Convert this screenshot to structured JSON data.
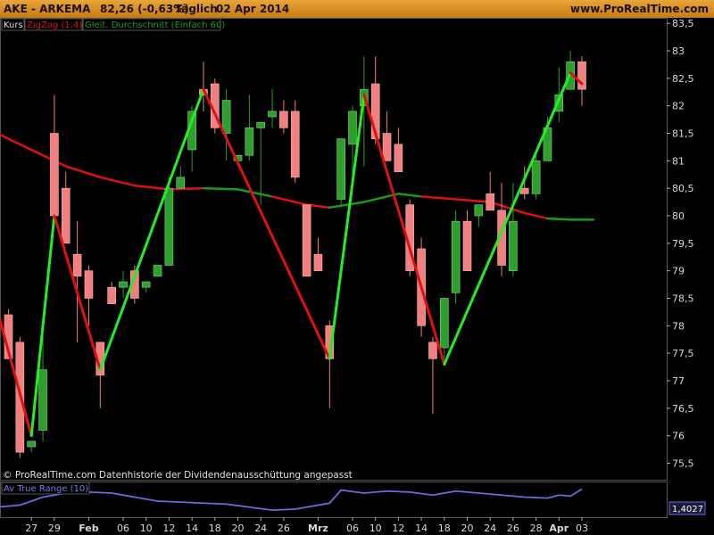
{
  "header": {
    "symbol": "AKE - ARKEMA",
    "price_change": "82,26 (-0,63%)",
    "period": "Täglich",
    "date": "02 Apr 2014",
    "site": "www.ProRealTime.com"
  },
  "legend": {
    "kurs": "Kurs",
    "zigzag": "ZigZag (1,4)",
    "ma": "Gleit. Durchschnitt (Einfach 60)"
  },
  "footer_note": "© ProRealTime.com  Datenhistorie der Dividendenausschüttung angepasst",
  "colors": {
    "up_candle": "#2e9e2e",
    "down_candle": "#f08080",
    "zigzag_up": "#22ee22",
    "zigzag_down": "#dd1111",
    "ma_above": "#dd1111",
    "ma_below": "#1a9a1a",
    "atr_line": "#6b6bdd",
    "title_bar": "#e0962a"
  },
  "chart_data": [
    {
      "type": "candlestick",
      "y_ticks": [
        "75,5",
        "76",
        "76,5",
        "77",
        "77,5",
        "78",
        "78,5",
        "79",
        "79,5",
        "80",
        "80,5",
        "81",
        "81,5",
        "82",
        "82,5",
        "83",
        "83,5"
      ],
      "ylim": [
        75.2,
        83.6
      ],
      "x_ticks": [
        {
          "label": "27",
          "i": 2
        },
        {
          "label": "29",
          "i": 4
        },
        {
          "label": "Feb",
          "i": 7,
          "bold": true
        },
        {
          "label": "06",
          "i": 10
        },
        {
          "label": "10",
          "i": 12
        },
        {
          "label": "12",
          "i": 14
        },
        {
          "label": "14",
          "i": 16
        },
        {
          "label": "18",
          "i": 18
        },
        {
          "label": "20",
          "i": 20
        },
        {
          "label": "24",
          "i": 22
        },
        {
          "label": "26",
          "i": 24
        },
        {
          "label": "Mrz",
          "i": 27,
          "bold": true
        },
        {
          "label": "06",
          "i": 30
        },
        {
          "label": "10",
          "i": 32
        },
        {
          "label": "12",
          "i": 34
        },
        {
          "label": "14",
          "i": 36
        },
        {
          "label": "18",
          "i": 38
        },
        {
          "label": "20",
          "i": 40
        },
        {
          "label": "24",
          "i": 42
        },
        {
          "label": "26",
          "i": 44
        },
        {
          "label": "28",
          "i": 46
        },
        {
          "label": "Apr",
          "i": 48,
          "bold": true
        },
        {
          "label": "03",
          "i": 50
        }
      ],
      "candles": [
        {
          "o": 78.2,
          "h": 78.3,
          "l": 77.4,
          "c": 77.4
        },
        {
          "o": 77.7,
          "h": 77.8,
          "l": 75.6,
          "c": 75.7
        },
        {
          "o": 75.8,
          "h": 75.9,
          "l": 75.7,
          "c": 75.9
        },
        {
          "o": 76.1,
          "h": 77.9,
          "l": 75.9,
          "c": 77.2
        },
        {
          "o": 81.5,
          "h": 82.2,
          "l": 79.9,
          "c": 80.0
        },
        {
          "o": 80.5,
          "h": 80.8,
          "l": 79.5,
          "c": 79.5
        },
        {
          "o": 79.3,
          "h": 79.9,
          "l": 77.7,
          "c": 78.9
        },
        {
          "o": 79.0,
          "h": 79.1,
          "l": 78.0,
          "c": 78.5
        },
        {
          "o": 77.7,
          "h": 77.7,
          "l": 76.5,
          "c": 77.1
        },
        {
          "o": 78.7,
          "h": 78.8,
          "l": 78.4,
          "c": 78.4
        },
        {
          "o": 78.7,
          "h": 79.0,
          "l": 78.5,
          "c": 78.8
        },
        {
          "o": 79.0,
          "h": 79.1,
          "l": 78.4,
          "c": 78.5
        },
        {
          "o": 78.7,
          "h": 78.8,
          "l": 78.6,
          "c": 78.8
        },
        {
          "o": 78.9,
          "h": 79.1,
          "l": 78.9,
          "c": 79.1
        },
        {
          "o": 79.1,
          "h": 80.7,
          "l": 79.1,
          "c": 80.5
        },
        {
          "o": 80.5,
          "h": 80.9,
          "l": 80.5,
          "c": 80.7
        },
        {
          "o": 81.2,
          "h": 82.0,
          "l": 80.8,
          "c": 81.9
        },
        {
          "o": 82.3,
          "h": 82.8,
          "l": 81.9,
          "c": 82.2
        },
        {
          "o": 82.4,
          "h": 82.5,
          "l": 81.5,
          "c": 81.6
        },
        {
          "o": 81.5,
          "h": 82.3,
          "l": 81.0,
          "c": 82.1
        },
        {
          "o": 81.0,
          "h": 81.1,
          "l": 80.9,
          "c": 81.1
        },
        {
          "o": 81.1,
          "h": 82.2,
          "l": 81.0,
          "c": 81.6
        },
        {
          "o": 81.6,
          "h": 81.7,
          "l": 80.2,
          "c": 81.7
        },
        {
          "o": 81.8,
          "h": 82.3,
          "l": 81.6,
          "c": 81.9
        },
        {
          "o": 81.9,
          "h": 82.1,
          "l": 81.5,
          "c": 81.6
        },
        {
          "o": 81.9,
          "h": 82.1,
          "l": 80.6,
          "c": 80.7
        },
        {
          "o": 80.2,
          "h": 80.2,
          "l": 78.9,
          "c": 78.9
        },
        {
          "o": 79.3,
          "h": 79.6,
          "l": 79.0,
          "c": 79.0
        },
        {
          "o": 78.0,
          "h": 78.1,
          "l": 76.5,
          "c": 77.4
        },
        {
          "o": 80.3,
          "h": 81.4,
          "l": 80.2,
          "c": 81.4
        },
        {
          "o": 81.3,
          "h": 82.0,
          "l": 80.6,
          "c": 81.9
        },
        {
          "o": 82.0,
          "h": 82.9,
          "l": 80.9,
          "c": 82.3
        },
        {
          "o": 82.4,
          "h": 82.9,
          "l": 81.3,
          "c": 81.4
        },
        {
          "o": 81.5,
          "h": 81.9,
          "l": 81.1,
          "c": 81.0
        },
        {
          "o": 81.3,
          "h": 81.6,
          "l": 80.8,
          "c": 80.8
        },
        {
          "o": 80.2,
          "h": 80.3,
          "l": 78.9,
          "c": 79.0
        },
        {
          "o": 79.4,
          "h": 79.6,
          "l": 77.8,
          "c": 78.0
        },
        {
          "o": 77.7,
          "h": 77.8,
          "l": 76.4,
          "c": 77.4
        },
        {
          "o": 77.6,
          "h": 78.5,
          "l": 77.4,
          "c": 78.5
        },
        {
          "o": 78.6,
          "h": 80.1,
          "l": 78.4,
          "c": 79.9
        },
        {
          "o": 79.9,
          "h": 80.1,
          "l": 79.0,
          "c": 79.0
        },
        {
          "o": 80.0,
          "h": 80.2,
          "l": 79.8,
          "c": 80.2
        },
        {
          "o": 80.4,
          "h": 80.8,
          "l": 80.2,
          "c": 80.1
        },
        {
          "o": 80.1,
          "h": 80.6,
          "l": 78.9,
          "c": 79.1
        },
        {
          "o": 79.0,
          "h": 80.6,
          "l": 78.9,
          "c": 79.9
        },
        {
          "o": 80.5,
          "h": 80.9,
          "l": 80.3,
          "c": 80.4
        },
        {
          "o": 80.4,
          "h": 81.1,
          "l": 80.3,
          "c": 81.0
        },
        {
          "o": 81.0,
          "h": 81.8,
          "l": 81.0,
          "c": 81.6
        },
        {
          "o": 81.9,
          "h": 82.7,
          "l": 81.7,
          "c": 82.2
        },
        {
          "o": 82.3,
          "h": 83.0,
          "l": 82.3,
          "c": 82.8
        },
        {
          "o": 82.8,
          "h": 82.9,
          "l": 82.0,
          "c": 82.3
        }
      ],
      "zigzag": [
        {
          "i": -1,
          "v": 78.3
        },
        {
          "i": 2,
          "v": 76.0
        },
        {
          "i": 4,
          "v": 80.0
        },
        {
          "i": 8,
          "v": 77.2
        },
        {
          "i": 17,
          "v": 82.3
        },
        {
          "i": 28,
          "v": 77.4
        },
        {
          "i": 31,
          "v": 82.2
        },
        {
          "i": 38,
          "v": 77.3
        },
        {
          "i": 49,
          "v": 82.6
        },
        {
          "i": 50,
          "v": 82.4
        }
      ],
      "moving_average": [
        {
          "i": -1,
          "v": 81.5
        },
        {
          "i": 2,
          "v": 81.2
        },
        {
          "i": 5,
          "v": 80.9
        },
        {
          "i": 8,
          "v": 80.7
        },
        {
          "i": 11,
          "v": 80.55
        },
        {
          "i": 14,
          "v": 80.48
        },
        {
          "i": 17,
          "v": 80.5
        },
        {
          "i": 20,
          "v": 80.48
        },
        {
          "i": 23,
          "v": 80.35
        },
        {
          "i": 26,
          "v": 80.2
        },
        {
          "i": 28,
          "v": 80.15
        },
        {
          "i": 31,
          "v": 80.25
        },
        {
          "i": 34,
          "v": 80.4
        },
        {
          "i": 36,
          "v": 80.35
        },
        {
          "i": 39,
          "v": 80.3
        },
        {
          "i": 42,
          "v": 80.25
        },
        {
          "i": 45,
          "v": 80.05
        },
        {
          "i": 47,
          "v": 79.95
        },
        {
          "i": 49,
          "v": 79.93
        },
        {
          "i": 51,
          "v": 79.93
        }
      ]
    },
    {
      "type": "line",
      "name": "Av True Range (10)",
      "last_value": "1,4027",
      "values": [
        {
          "i": -1,
          "v": 0.5
        },
        {
          "i": 1,
          "v": 0.6
        },
        {
          "i": 3,
          "v": 1.0
        },
        {
          "i": 5,
          "v": 1.2
        },
        {
          "i": 7,
          "v": 1.25
        },
        {
          "i": 9,
          "v": 1.2
        },
        {
          "i": 11,
          "v": 1.0
        },
        {
          "i": 13,
          "v": 0.8
        },
        {
          "i": 15,
          "v": 0.75
        },
        {
          "i": 17,
          "v": 0.7
        },
        {
          "i": 19,
          "v": 0.65
        },
        {
          "i": 21,
          "v": 0.5
        },
        {
          "i": 23,
          "v": 0.35
        },
        {
          "i": 25,
          "v": 0.4
        },
        {
          "i": 26,
          "v": 0.5
        },
        {
          "i": 28,
          "v": 0.7
        },
        {
          "i": 29,
          "v": 1.35
        },
        {
          "i": 31,
          "v": 1.2
        },
        {
          "i": 33,
          "v": 1.3
        },
        {
          "i": 35,
          "v": 1.25
        },
        {
          "i": 37,
          "v": 1.1
        },
        {
          "i": 39,
          "v": 1.3
        },
        {
          "i": 41,
          "v": 1.2
        },
        {
          "i": 43,
          "v": 1.1
        },
        {
          "i": 45,
          "v": 1.0
        },
        {
          "i": 47,
          "v": 0.95
        },
        {
          "i": 48,
          "v": 1.1
        },
        {
          "i": 49,
          "v": 1.05
        },
        {
          "i": 50,
          "v": 1.4
        }
      ],
      "ylim": [
        0,
        1.6
      ]
    }
  ]
}
